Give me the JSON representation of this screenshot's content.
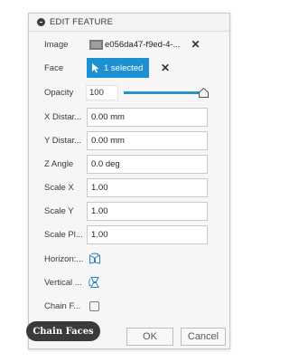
{
  "dialog": {
    "title": "EDIT FEATURE",
    "image": {
      "label": "Image",
      "filename": "e056da47-f9ed-4-...",
      "clear_icon": "close-icon"
    },
    "face": {
      "label": "Face",
      "selection_text": "1 selected",
      "clear_icon": "close-icon"
    },
    "opacity": {
      "label": "Opacity",
      "value": "100",
      "slider_fraction": 1.0
    },
    "x_distance": {
      "label": "X Distar...",
      "value": "0.00 mm"
    },
    "y_distance": {
      "label": "Y Distar...",
      "value": "0.00 mm"
    },
    "z_angle": {
      "label": "Z Angle",
      "value": "0.0 deg"
    },
    "scale_x": {
      "label": "Scale X",
      "value": "1.00"
    },
    "scale_y": {
      "label": "Scale Y",
      "value": "1.00"
    },
    "scale_plane": {
      "label": "Scale Pl...",
      "value": "1.00"
    },
    "horizontal_flip": {
      "label": "Horizon:...",
      "icon": "flip-horizontal-icon"
    },
    "vertical_flip": {
      "label": "Vertical ...",
      "icon": "flip-vertical-icon"
    },
    "chain_faces": {
      "label": "Chain F...",
      "checked": false
    },
    "buttons": {
      "ok": "OK",
      "cancel": "Cancel"
    }
  },
  "tooltip": {
    "text": "Chain Faces"
  },
  "colors": {
    "accent": "#1d90d2",
    "tooltip_bg": "#3a3a3a",
    "panel_bg": "#f6f6f6"
  }
}
